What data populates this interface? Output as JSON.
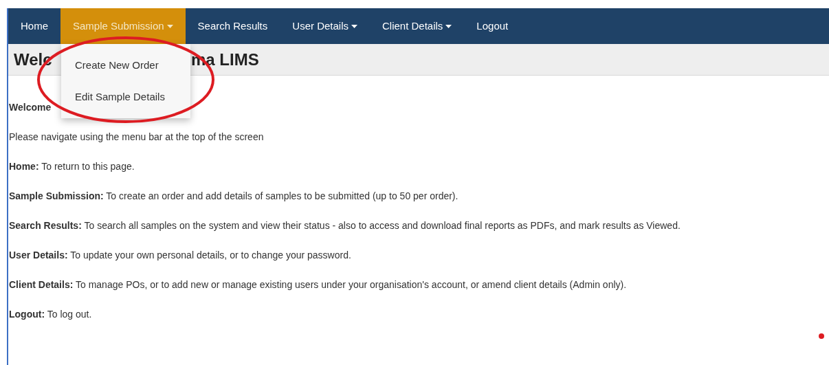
{
  "nav": [
    {
      "label": "Home",
      "selected": false,
      "has_menu": false
    },
    {
      "label": "Sample Submission",
      "selected": true,
      "has_menu": true
    },
    {
      "label": "Search Results",
      "selected": false,
      "has_menu": false
    },
    {
      "label": "User Details",
      "selected": false,
      "has_menu": true
    },
    {
      "label": "Client Details",
      "selected": false,
      "has_menu": true
    },
    {
      "label": "Logout",
      "selected": false,
      "has_menu": false
    }
  ],
  "dropdown": [
    "Create New Order",
    "Edit Sample Details"
  ],
  "heading_parts": [
    "Welc",
    "ma LIMS"
  ],
  "welcome": "Welcome",
  "paragraphs": [
    "Please navigate using the menu bar at the top of the screen",
    "**Home:** To return to this page.",
    "**Sample Submission:** To create an order and add details of samples to be submitted (up to 50 per order).",
    "**Search Results:** To search all samples on the system and view their status - also to access and download final reports as PDFs, and mark results as Viewed.",
    "**User Details:** To update your own personal details, or to change your password.",
    "**Client Details:** To manage POs, or to add new or manage existing users under your organisation's account, or amend client details (Admin only).",
    "**Logout:** To log out."
  ]
}
